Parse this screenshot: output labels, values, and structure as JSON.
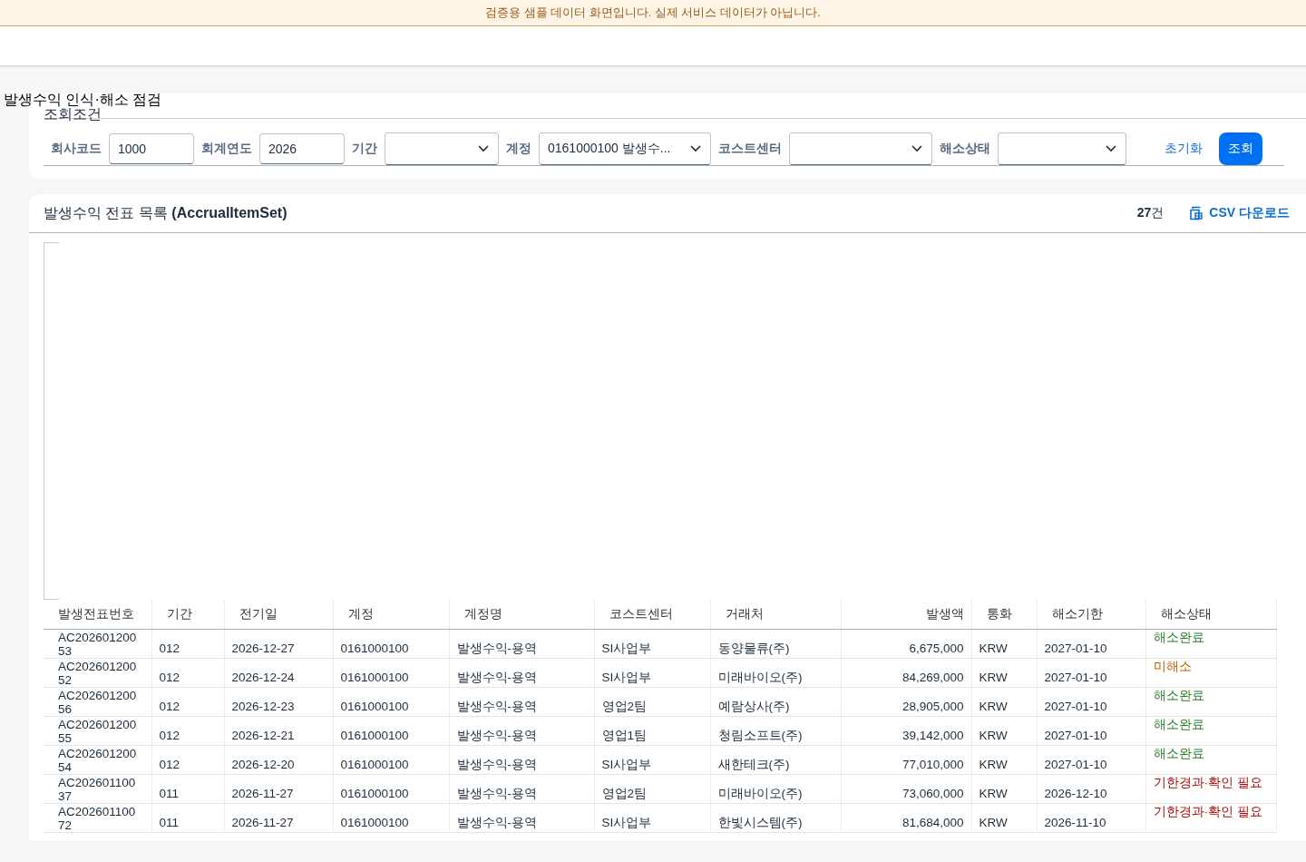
{
  "banner": {
    "text": "검증용 샘플 데이터 화면입니다. 실제 서비스 데이터가 아닙니다."
  },
  "page_title": "발생수익 인식·해소 점검",
  "filter_card": {
    "title": "조회조건",
    "fields": [
      {
        "label": "회사코드",
        "kind": "input",
        "value": "1000"
      },
      {
        "label": "회계연도",
        "kind": "input",
        "value": "2026"
      },
      {
        "label": "기간",
        "kind": "select"
      },
      {
        "label": "계정",
        "kind": "select",
        "value": "0161000100 발생수..."
      },
      {
        "label": "코스트센터",
        "kind": "select"
      },
      {
        "label": "해소상태",
        "kind": "select"
      }
    ],
    "buttons": [
      {
        "label": "초기화",
        "kind": "link"
      },
      {
        "label": "조회",
        "kind": "primary"
      }
    ]
  },
  "list_card": {
    "title": "발생수익 전표 목록 **(AccrualItemSet)**",
    "count": "**27**건",
    "download": "CSV 다운로드",
    "table": {
      "columns": [
        "발생전표번호",
        "기간",
        "전기일",
        "계정",
        "계정명",
        "코스트센터",
        "거래처",
        "발생액",
        "통화",
        "해소기한",
        "해소상태"
      ],
      "rows": [
        {
          "cells": [
            "AC202601200 53",
            "012",
            "2026-12-27",
            "0161000100",
            "발생수익-용역",
            "SI사업부",
            "동양물류(주)",
            "6,675,000",
            "KRW",
            "2027-01-10"
          ],
          "status": "해소완료",
          "kind": "done"
        },
        {
          "cells": [
            "AC202601200 52",
            "012",
            "2026-12-24",
            "0161000100",
            "발생수익-용역",
            "SI사업부",
            "미래바이오(주)",
            "84,269,000",
            "KRW",
            "2027-01-10"
          ],
          "status": "미해소",
          "kind": "open"
        },
        {
          "cells": [
            "AC202601200 56",
            "012",
            "2026-12-23",
            "0161000100",
            "발생수익-용역",
            "영업2팀",
            "예람상사(주)",
            "28,905,000",
            "KRW",
            "2027-01-10"
          ],
          "status": "해소완료",
          "kind": "done"
        },
        {
          "cells": [
            "AC202601200 55",
            "012",
            "2026-12-21",
            "0161000100",
            "발생수익-용역",
            "영업1팀",
            "청림소프트(주)",
            "39,142,000",
            "KRW",
            "2027-01-10"
          ],
          "status": "해소완료",
          "kind": "done"
        },
        {
          "cells": [
            "AC202601200 54",
            "012",
            "2026-12-20",
            "0161000100",
            "발생수익-용역",
            "SI사업부",
            "새한테크(주)",
            "77,010,000",
            "KRW",
            "2027-01-10"
          ],
          "status": "해소완료",
          "kind": "done"
        },
        {
          "cells": [
            "AC202601100 37",
            "011",
            "2026-11-27",
            "0161000100",
            "발생수익-용역",
            "영업2팀",
            "미래바이오(주)",
            "73,060,000",
            "KRW",
            "2026-12-10"
          ],
          "status": "기한경과·확인 필요",
          "kind": "overdue"
        },
        {
          "cells": [
            "AC202601100 72",
            "011",
            "2026-11-27",
            "0161000100",
            "발생수익-용역",
            "SI사업부",
            "한빛시스템(주)",
            "81,684,000",
            "KRW",
            "2026-11-10"
          ],
          "status": "기한경과·확인 필요",
          "kind": "overdue"
        }
      ]
    }
  }
}
